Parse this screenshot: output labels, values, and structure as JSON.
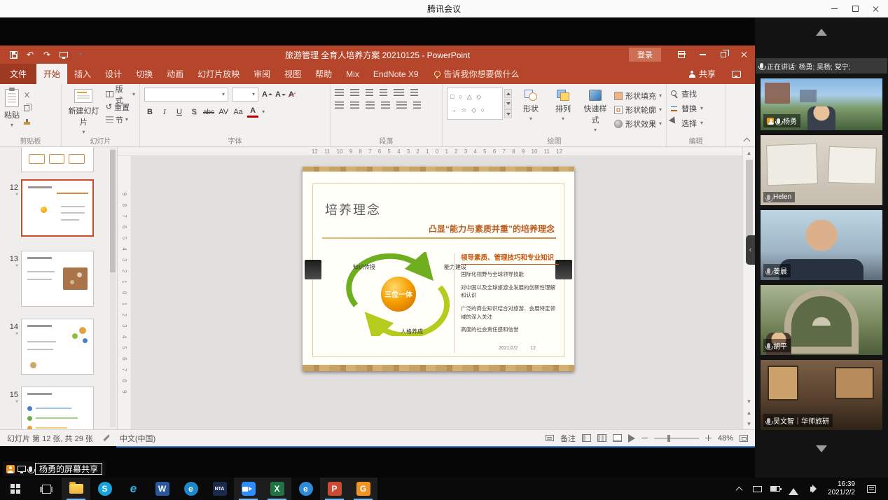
{
  "meeting": {
    "window_title": "腾讯会议",
    "speaking_label": "正在讲话: 杨勇; 吴杨; 党宁;",
    "share_badge": "杨勇的屏幕共享",
    "participants": [
      {
        "name": "杨勇"
      },
      {
        "name": "Helen"
      },
      {
        "name": "姜晨"
      },
      {
        "name": "胡平"
      },
      {
        "name": "吴文智｜华师旅研"
      }
    ]
  },
  "ppt": {
    "window_title": "旅游管理 全育人培养方案 20210125  -  PowerPoint",
    "login": "登录",
    "menus": [
      "文件",
      "开始",
      "插入",
      "设计",
      "切换",
      "动画",
      "幻灯片放映",
      "审阅",
      "视图",
      "帮助",
      "Mix",
      "EndNote X9"
    ],
    "tell_me": "告诉我你想要做什么",
    "share": "共享",
    "ribbon": {
      "paste": "粘贴",
      "new_slide": "新建幻灯片",
      "layout": "版式",
      "reset": "重置",
      "section": "节",
      "font_buttons": {
        "bold": "B",
        "italic": "I",
        "underline": "U",
        "shadow": "S",
        "strike": "abc",
        "spacing": "AV",
        "case": "Aa",
        "color": "A",
        "size_up": "A",
        "size_down": "A",
        "clear": "A"
      },
      "shapes": "形状",
      "arrange": "排列",
      "quick_styles": "快速样式",
      "shape_fill": "形状填充",
      "shape_outline": "形状轮廓",
      "shape_effects": "形状效果",
      "find": "查找",
      "replace": "替换",
      "select": "选择",
      "groups": [
        "剪贴板",
        "幻灯片",
        "字体",
        "段落",
        "绘图",
        "编辑"
      ]
    },
    "rulers": {
      "horizontal": "12 11 10 9 8 7 6 5 4 3 2 1 0 1 2 3 4 5 6 7 8 9 10 11 12",
      "vertical": "9 8 7 6 5 4 3 2 1 0 1 2 3 4 5 6 7 8 9"
    },
    "thumbnails": [
      {
        "number": "12"
      },
      {
        "number": "13"
      },
      {
        "number": "14"
      },
      {
        "number": "15"
      }
    ],
    "slide": {
      "title": "培养理念",
      "headline": "凸显“能力与素质并重”的培养理念",
      "core": "三位一体",
      "node_top_left": "知识传授",
      "node_top_right": "能力建设",
      "node_bottom": "人格养成",
      "right_heading": "领导素质、管理技巧和专业知识",
      "bullets": [
        "国际化视野与全球领导技能",
        "对中国以及全球旅游业发展的创新性理解和认识",
        "广泛的商业知识结合对旅游、会展特定领域的深入关注",
        "高度的社会责任感和信誉"
      ],
      "date": "2021/2/2",
      "page_number": "12"
    },
    "statusbar": {
      "slide_position": "幻灯片 第 12 张, 共 29 张",
      "language": "中文(中国)",
      "notes": "备注",
      "zoom_level": "48%"
    }
  },
  "taskbar": {
    "apps": {
      "skype": "S",
      "ie": "e",
      "word": "W",
      "edge": "e",
      "nta": "NTA",
      "excel": "X",
      "browser": "e",
      "powerpoint": "P",
      "gapp": "G"
    },
    "clock_time": "16:39",
    "clock_date": "2021/2/2"
  },
  "icons": {
    "dropdown": "▾",
    "scroll_up": "▲",
    "scroll_down": "▼",
    "prev_slide": "▲",
    "next_slide": "▼",
    "collapse": "‹",
    "undo": "↶",
    "redo": "↷",
    "reset_glyph": "↺",
    "star": "*",
    "shapes_row1": "□ ○ △ ◇",
    "shapes_row2": "→ ☆ ◇ ○"
  }
}
